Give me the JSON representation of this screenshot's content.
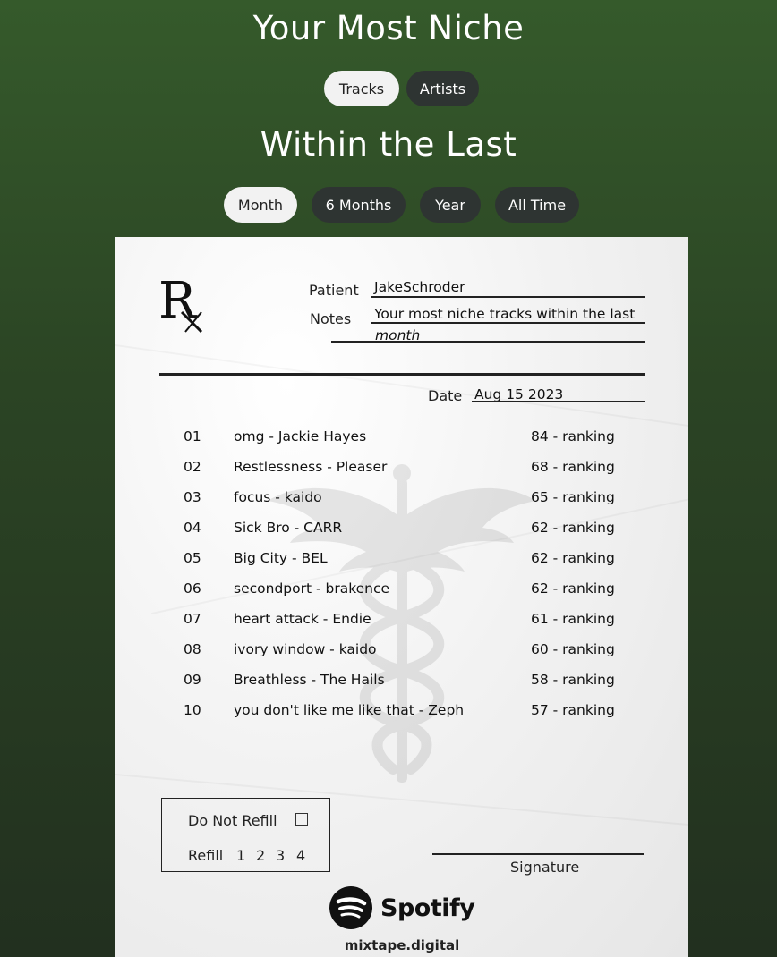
{
  "header": {
    "title": "Your Most Niche",
    "type_tabs": [
      {
        "label": "Tracks",
        "active": true
      },
      {
        "label": "Artists",
        "active": false
      }
    ],
    "subtitle": "Within the Last",
    "range_tabs": [
      {
        "label": "Month",
        "active": true
      },
      {
        "label": "6 Months",
        "active": false
      },
      {
        "label": "Year",
        "active": false
      },
      {
        "label": "All Time",
        "active": false
      }
    ]
  },
  "prescription": {
    "rx_symbol": "Rx",
    "patient_label": "Patient",
    "patient_name": "JakeSchroder",
    "notes_label": "Notes",
    "notes_line1": "Your most niche tracks within the last",
    "notes_line2": "month",
    "date_label": "Date",
    "date_value": "Aug 15 2023",
    "tracks": [
      {
        "num": "01",
        "track": "omg - Jackie Hayes",
        "ranking": "84 - ranking"
      },
      {
        "num": "02",
        "track": "Restlessness - Pleaser",
        "ranking": "68 - ranking"
      },
      {
        "num": "03",
        "track": "focus - kaido",
        "ranking": "65 - ranking"
      },
      {
        "num": "04",
        "track": "Sick Bro - CARR",
        "ranking": "62 - ranking"
      },
      {
        "num": "05",
        "track": "Big City - BEL",
        "ranking": "62 - ranking"
      },
      {
        "num": "06",
        "track": "secondport - brakence",
        "ranking": "62 - ranking"
      },
      {
        "num": "07",
        "track": "heart attack - Endie",
        "ranking": "61 - ranking"
      },
      {
        "num": "08",
        "track": "ivory window - kaido",
        "ranking": "60 - ranking"
      },
      {
        "num": "09",
        "track": "Breathless - The Hails",
        "ranking": "58 - ranking"
      },
      {
        "num": "10",
        "track": "you don't like me like that - Zeph",
        "ranking": "57 - ranking"
      }
    ],
    "do_not_refill_label": "Do Not Refill",
    "refill_label": "Refill",
    "refill_options": [
      "1",
      "2",
      "3",
      "4"
    ],
    "signature_label": "Signature",
    "brand": "Spotify",
    "site": "mixtape.digital",
    "watermark_icon": "caduceus-icon",
    "brand_icon": "spotify-icon"
  },
  "colors": {
    "bg_top": "#355a2b",
    "bg_bottom": "#22301f",
    "pill_active": "#f2f2f2",
    "pill_inactive": "#2e3432"
  }
}
